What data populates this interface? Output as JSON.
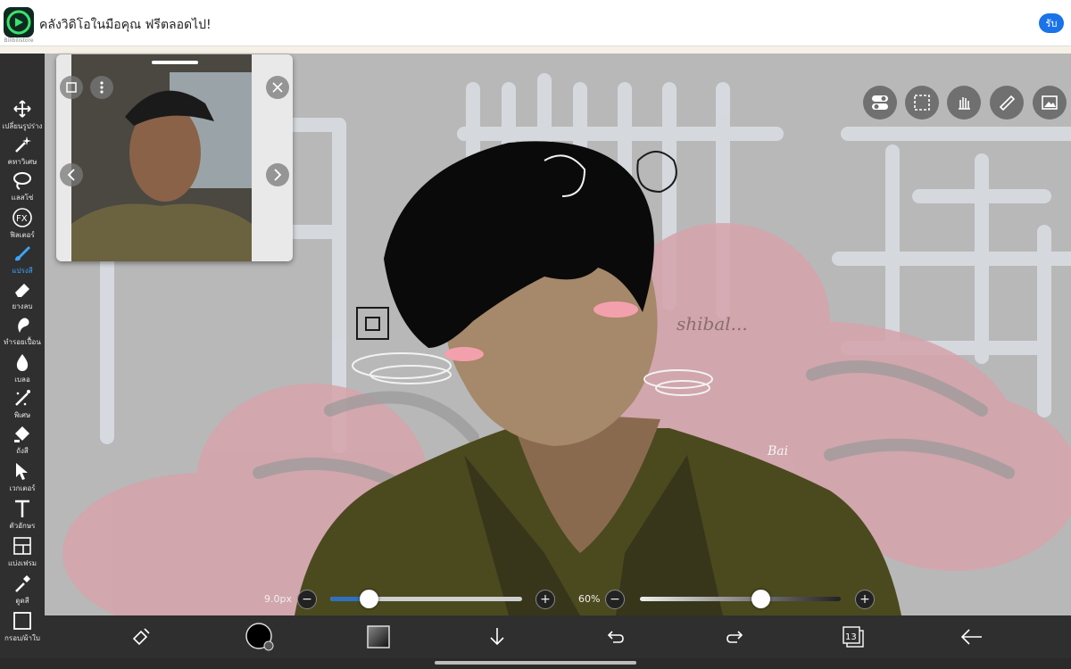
{
  "ad": {
    "text": "คลังวิดิโอในมือคุณ ฟรีตลอดไป!",
    "logo_caption": "Bilibilistore",
    "button_label": "รับ",
    "accent": "#1a73e8"
  },
  "sidebar": {
    "active_color": "#3ca5ff",
    "items": [
      {
        "label": "เปลี่ยนรูปร่าง",
        "icon": "move-arrows-icon"
      },
      {
        "label": "คทาวิเศษ",
        "icon": "magic-wand-icon"
      },
      {
        "label": "แลสโซ่",
        "icon": "lasso-icon"
      },
      {
        "label": "ฟิลเตอร์",
        "icon": "fx-filter-icon"
      },
      {
        "label": "แปรงสี",
        "icon": "brush-icon"
      },
      {
        "label": "ยางลบ",
        "icon": "eraser-icon"
      },
      {
        "label": "ทำรอยเปื้อน",
        "icon": "smudge-icon"
      },
      {
        "label": "เบลอ",
        "icon": "blur-drop-icon"
      },
      {
        "label": "พิเศษ",
        "icon": "special-sparkle-icon"
      },
      {
        "label": "ถังสี",
        "icon": "paint-bucket-icon"
      },
      {
        "label": "เวกเตอร์",
        "icon": "vector-cursor-icon"
      },
      {
        "label": "ตัวอักษร",
        "icon": "text-tool-icon"
      },
      {
        "label": "แบ่งเฟรม",
        "icon": "frame-divider-icon"
      },
      {
        "label": "ดูดสี",
        "icon": "eyedropper-icon"
      },
      {
        "label": "กรอบ/ผ้าใบ",
        "icon": "canvas-frame-icon"
      }
    ],
    "active_index": 4
  },
  "drawing": {
    "handwritten_text": "shibal...",
    "signature": "Bai"
  },
  "top_tools": [
    "toggle-icon",
    "selection-icon",
    "hand-scroll-icon",
    "ruler-icon",
    "image-reference-icon"
  ],
  "brush": {
    "size_label": "9.0px",
    "size_fraction": 0.2,
    "opacity_label": "60%",
    "opacity_fraction": 0.6,
    "minus": "−",
    "plus": "+"
  },
  "bottom_bar": {
    "layer_count": "13",
    "icons": [
      "transform-eraser-icon",
      "color-swatch-icon",
      "gradient-swatch-icon",
      "download-arrow-icon",
      "undo-icon",
      "redo-icon",
      "layers-icon",
      "back-arrow-icon"
    ]
  }
}
